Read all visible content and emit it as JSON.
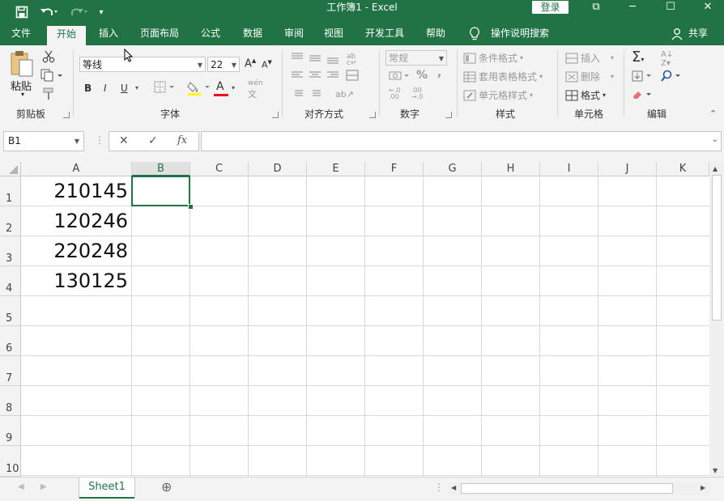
{
  "window": {
    "title": "工作簿1  -  Excel",
    "login": "登录",
    "minimize": "─",
    "restore": "☐",
    "close": "✕",
    "ribbon_display": "⧉"
  },
  "tabs": [
    "文件",
    "开始",
    "插入",
    "页面布局",
    "公式",
    "数据",
    "审阅",
    "视图",
    "开发工具",
    "帮助"
  ],
  "active_tab": "开始",
  "tell_me": "操作说明搜索",
  "share": "共享",
  "ribbon": {
    "clipboard": {
      "paste": "粘贴",
      "label": "剪贴板"
    },
    "font": {
      "name": "等线",
      "size": "22",
      "grow": "A",
      "shrink": "A",
      "bold": "B",
      "italic": "I",
      "underline": "U",
      "font_color": "A",
      "phonetic": "wén",
      "label": "字体"
    },
    "alignment": {
      "label": "对齐方式"
    },
    "number": {
      "format": "常规",
      "percent": "%",
      "comma": ",",
      "label": "数字"
    },
    "styles": {
      "conditional": "条件格式",
      "table_format": "套用表格格式",
      "cell_styles": "单元格样式",
      "label": "样式"
    },
    "cells": {
      "insert": "插入",
      "delete": "删除",
      "format": "格式",
      "label": "单元格"
    },
    "editing": {
      "label": "编辑"
    }
  },
  "formula_bar": {
    "name_box": "B1",
    "cancel": "✕",
    "enter": "✓",
    "fx": "fx",
    "value": ""
  },
  "columns": [
    "A",
    "B",
    "C",
    "D",
    "E",
    "F",
    "G",
    "H",
    "I",
    "J",
    "K"
  ],
  "selected_column": "B",
  "rows": [
    "1",
    "2",
    "3",
    "4",
    "5",
    "6",
    "7",
    "8",
    "9",
    "10"
  ],
  "cells": {
    "A1": "210145",
    "A2": "120246",
    "A3": "220248",
    "A4": "130125"
  },
  "sheet_tabs": [
    "Sheet1"
  ],
  "add_sheet": "⊕",
  "colors": {
    "accent": "#217346",
    "ribbon_bg": "#f3f3f3",
    "font_color_bar": "#e81123"
  }
}
